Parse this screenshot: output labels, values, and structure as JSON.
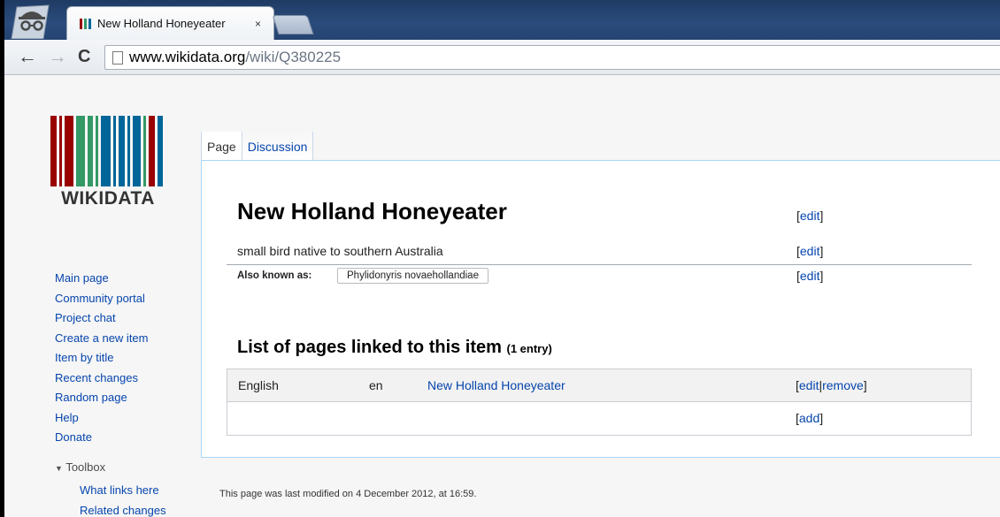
{
  "browser": {
    "tab_title": "New Holland Honeyeater",
    "tab_close": "×",
    "url_host": "www.wikidata.org",
    "url_path": "/wiki/Q380225"
  },
  "logo": {
    "text": "WIKIDATA",
    "colors": [
      "#990000",
      "#339966",
      "#006699"
    ]
  },
  "sidebar": {
    "items": [
      {
        "label": "Main page"
      },
      {
        "label": "Community portal"
      },
      {
        "label": "Project chat"
      },
      {
        "label": "Create a new item"
      },
      {
        "label": "Item by title"
      },
      {
        "label": "Recent changes"
      },
      {
        "label": "Random page"
      },
      {
        "label": "Help"
      },
      {
        "label": "Donate"
      }
    ],
    "toolbox": {
      "label": "Toolbox",
      "items": [
        {
          "label": "What links here"
        },
        {
          "label": "Related changes"
        }
      ]
    }
  },
  "tabs": {
    "page": "Page",
    "discussion": "Discussion"
  },
  "item": {
    "label": "New Holland Honeyeater",
    "description": "small bird native to southern Australia",
    "aliases_label": "Also known as:",
    "alias": "Phylidonyris novaehollandiae",
    "edit": "edit",
    "bracket_open": "[",
    "bracket_close": "]"
  },
  "sitelinks": {
    "title": "List of pages linked to this item",
    "count": "(1 entry)",
    "rows": [
      {
        "language": "English",
        "code": "en",
        "title": "New Holland Honeyeater"
      }
    ],
    "edit": "edit",
    "separator": "|",
    "remove": "remove",
    "add": "add"
  },
  "footer": {
    "text": "This page was last modified on 4 December 2012, at 16:59."
  },
  "colors": {
    "link": "#0645ad",
    "border_blue": "#a7d7f9"
  }
}
